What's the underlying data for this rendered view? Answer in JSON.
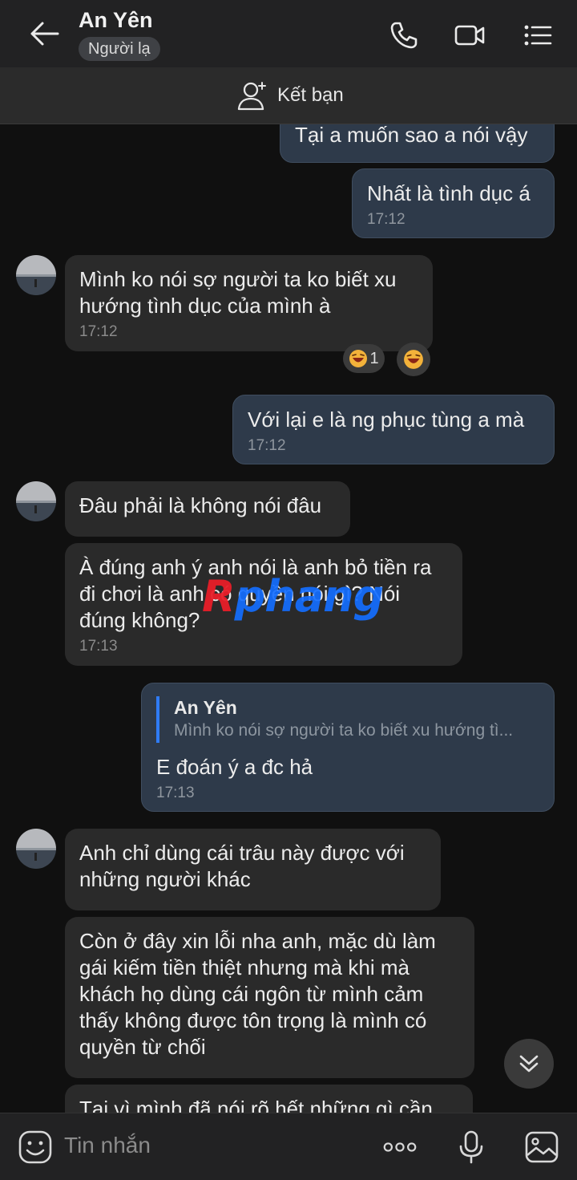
{
  "header": {
    "contact_name": "An Yên",
    "status_badge": "Người lạ",
    "add_friend_label": "Kết bạn"
  },
  "messages": [
    {
      "dir": "out",
      "text": "Tại a muốn sao a nói vậy",
      "time": ""
    },
    {
      "dir": "out",
      "text": "Nhất là tình dục á",
      "time": "17:12"
    },
    {
      "dir": "in",
      "text": "Mình ko nói sợ người ta ko biết xu hướng tình dục của mình à",
      "time": "17:12",
      "reaction_count": "1"
    },
    {
      "dir": "out",
      "text": "Với lại e là ng phục tùng a mà",
      "time": "17:12"
    },
    {
      "dir": "in",
      "text": "Đâu phải là không nói đâu",
      "time": ""
    },
    {
      "dir": "in",
      "text": "À đúng anh ý anh nói là anh bỏ tiền ra đi chơi là anh có quyền nói gì? Nói đúng không?",
      "time": "17:13"
    },
    {
      "dir": "out",
      "quote_name": "An Yên",
      "quote_text": "Mình ko nói sợ người ta ko biết xu hướng tì...",
      "text": "E đoán ý a đc hả",
      "time": "17:13"
    },
    {
      "dir": "in",
      "text": "Anh chỉ dùng cái trâu này được với những người khác",
      "time": ""
    },
    {
      "dir": "in",
      "text": "Còn ở đây xin lỗi nha anh, mặc dù làm gái kiếm tiền thiệt nhưng mà khi mà khách họ dùng cái ngôn từ mình cảm thấy không được tôn trọng là mình có quyền từ chối",
      "time": ""
    },
    {
      "dir": "in",
      "text": "Tại vì mình đã nói rõ hết những gì cần",
      "time": ""
    }
  ],
  "watermark": {
    "first": "R",
    "rest": "phang"
  },
  "composer": {
    "placeholder": "Tin nhắn"
  },
  "colors": {
    "accent": "#2f7cf6",
    "out_bubble": "#2e3a4a",
    "in_bubble": "#2a2a2a",
    "background": "#101010"
  },
  "icons": [
    "back-arrow-icon",
    "phone-icon",
    "video-call-icon",
    "menu-list-icon",
    "add-friend-icon",
    "emoji-icon",
    "more-dots-icon",
    "microphone-icon",
    "image-icon",
    "chevron-down-icon",
    "laughing-emoji-icon"
  ]
}
